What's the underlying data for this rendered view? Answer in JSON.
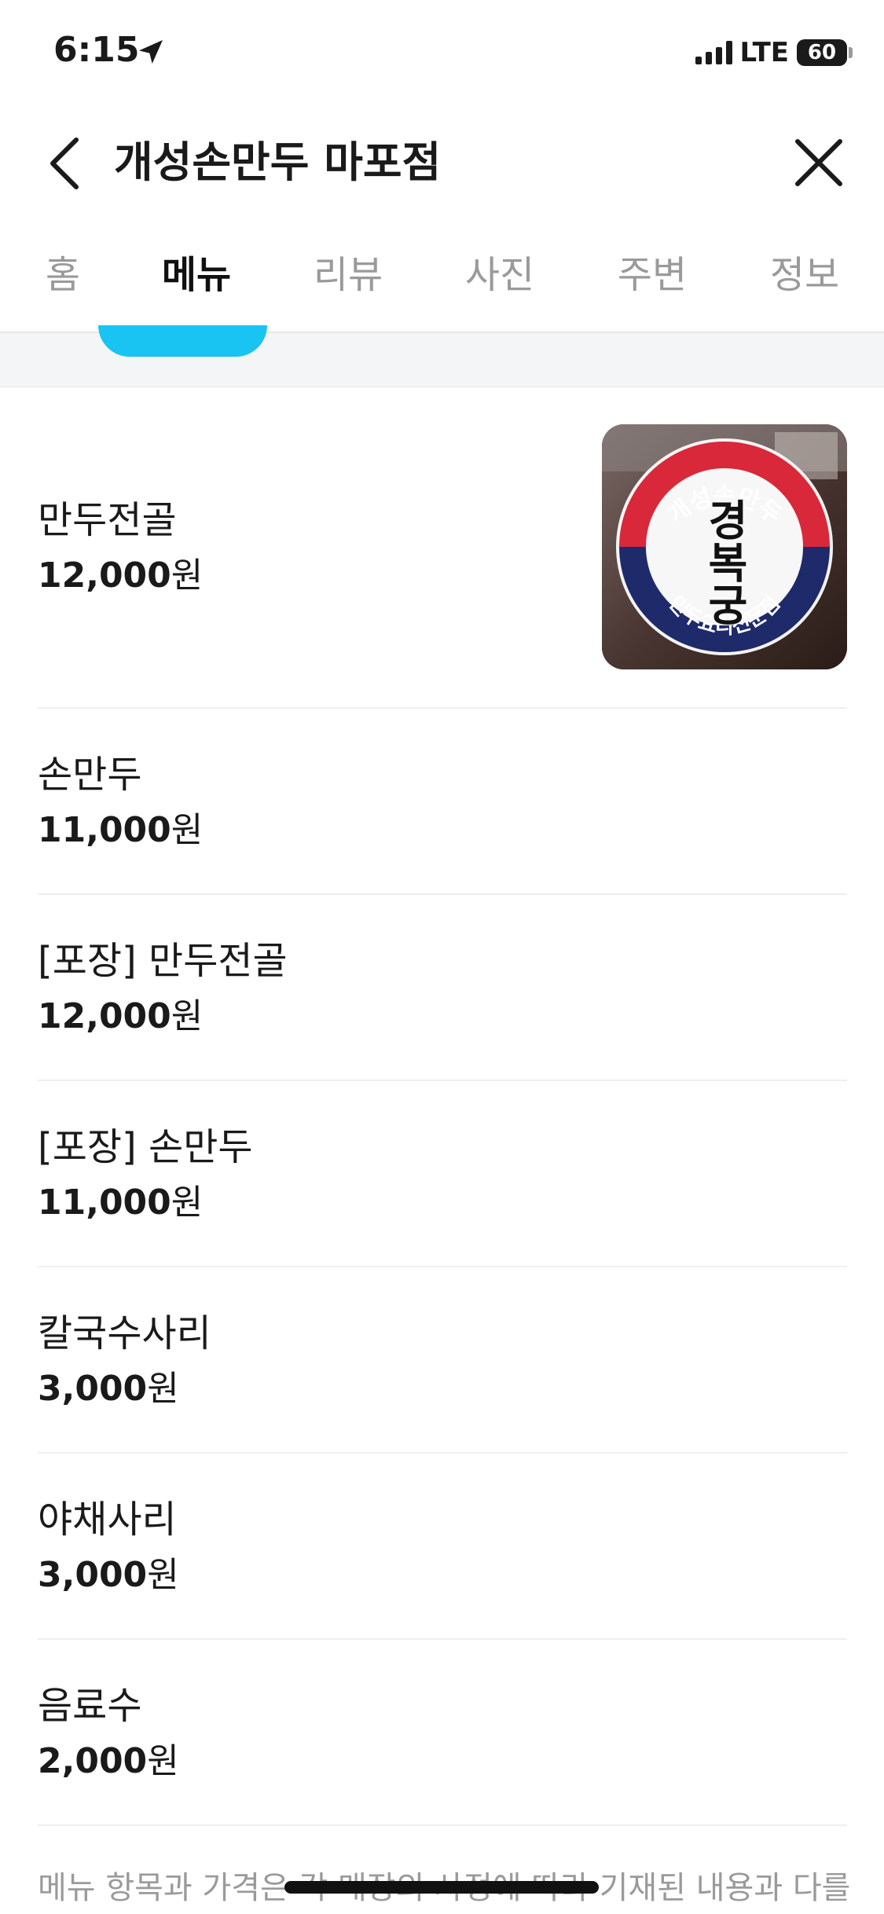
{
  "status_bar": {
    "time": "6:15",
    "network": "LTE",
    "battery": "60"
  },
  "header": {
    "title": "개성손만두 마포점"
  },
  "tabs": [
    {
      "label": "홈",
      "active": false
    },
    {
      "label": "메뉴",
      "active": true
    },
    {
      "label": "리뷰",
      "active": false
    },
    {
      "label": "사진",
      "active": false
    },
    {
      "label": "주변",
      "active": false
    },
    {
      "label": "정보",
      "active": false
    }
  ],
  "menu": {
    "items": [
      {
        "name": "만두전골",
        "price": "12,000",
        "currency": "원",
        "has_image": true
      },
      {
        "name": "손만두",
        "price": "11,000",
        "currency": "원"
      },
      {
        "name": "[포장] 만두전골",
        "price": "12,000",
        "currency": "원"
      },
      {
        "name": "[포장] 손만두",
        "price": "11,000",
        "currency": "원"
      },
      {
        "name": "칼국수사리",
        "price": "3,000",
        "currency": "원"
      },
      {
        "name": "야채사리",
        "price": "3,000",
        "currency": "원"
      },
      {
        "name": "음료수",
        "price": "2,000",
        "currency": "원"
      }
    ],
    "thumb_logo": {
      "top_text": "개성손만두",
      "center_text": "경복궁",
      "bottom_text": "만두요리전문점"
    }
  },
  "footnote": "메뉴 항목과 가격은 각 매장의 사정에 따라 기재된 내용과 다를 수",
  "colors": {
    "accent": "#19c3f2",
    "text": "#1a1a1a",
    "muted": "#9a9a9a",
    "logo_red": "#d8283a",
    "logo_blue": "#1f2a6b"
  }
}
